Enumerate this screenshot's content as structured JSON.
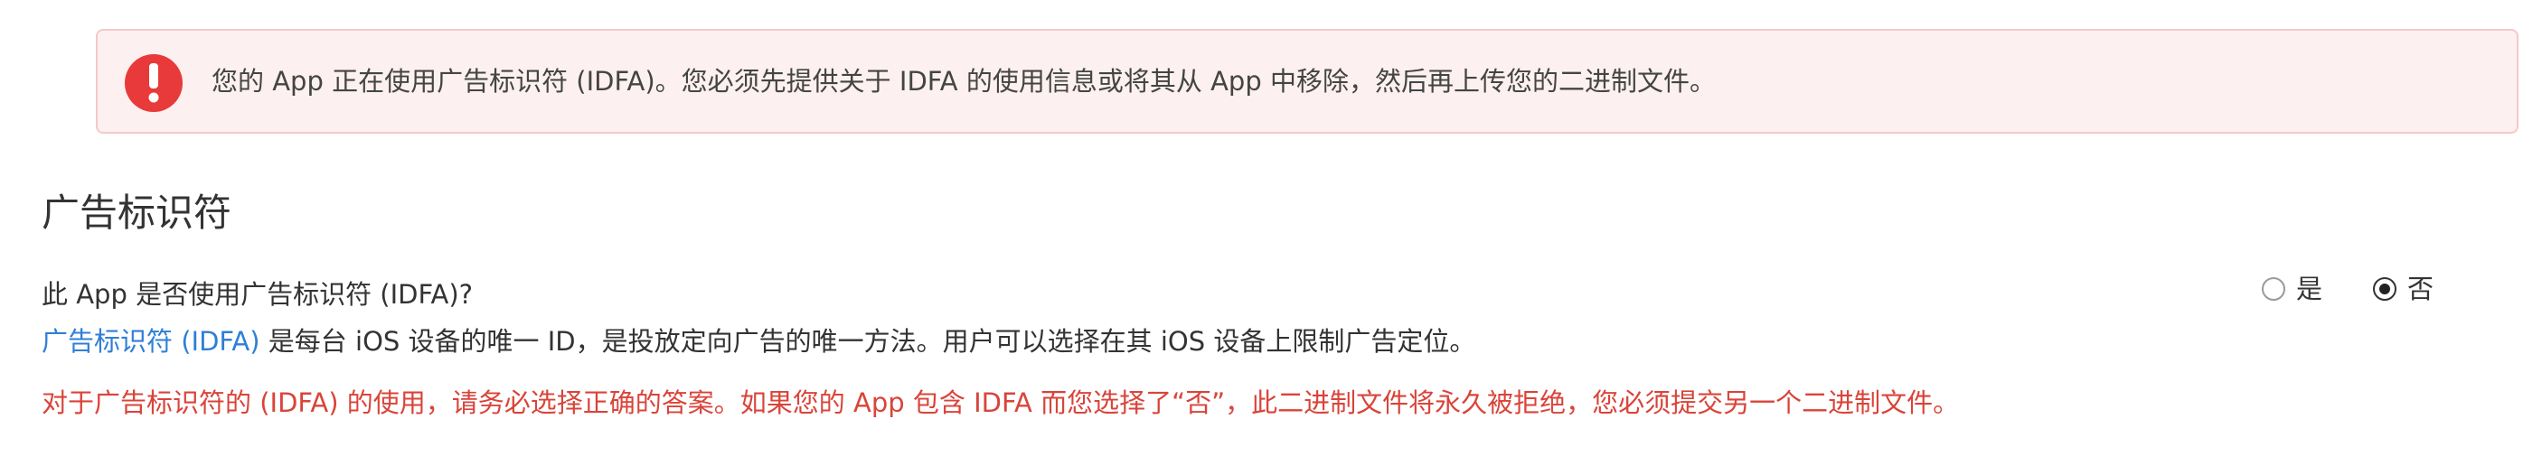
{
  "alert": {
    "icon": "exclamation-icon",
    "icon_color": "#e83a3a",
    "background": "#fdf0f0",
    "message": "您的 App 正在使用广告标识符 (IDFA)。您必须先提供关于 IDFA 的使用信息或将其从 App 中移除，然后再上传您的二进制文件。"
  },
  "section": {
    "title": "广告标识符"
  },
  "question": {
    "text": "此 App 是否使用广告标识符 (IDFA)?",
    "options": [
      {
        "label": "是",
        "selected": false
      },
      {
        "label": "否",
        "selected": true
      }
    ]
  },
  "description": {
    "link_text": "广告标识符 (IDFA)",
    "rest": " 是每台 iOS 设备的唯一 ID，是投放定向广告的唯一方法。用户可以选择在其 iOS 设备上限制广告定位。",
    "link_color": "#2f7fd6"
  },
  "warning": {
    "text": "对于广告标识符的 (IDFA) 的使用，请务必选择正确的答案。如果您的 App 包含 IDFA 而您选择了“否”，此二进制文件将永久被拒绝，您必须提交另一个二进制文件。",
    "color": "#d9443a"
  }
}
